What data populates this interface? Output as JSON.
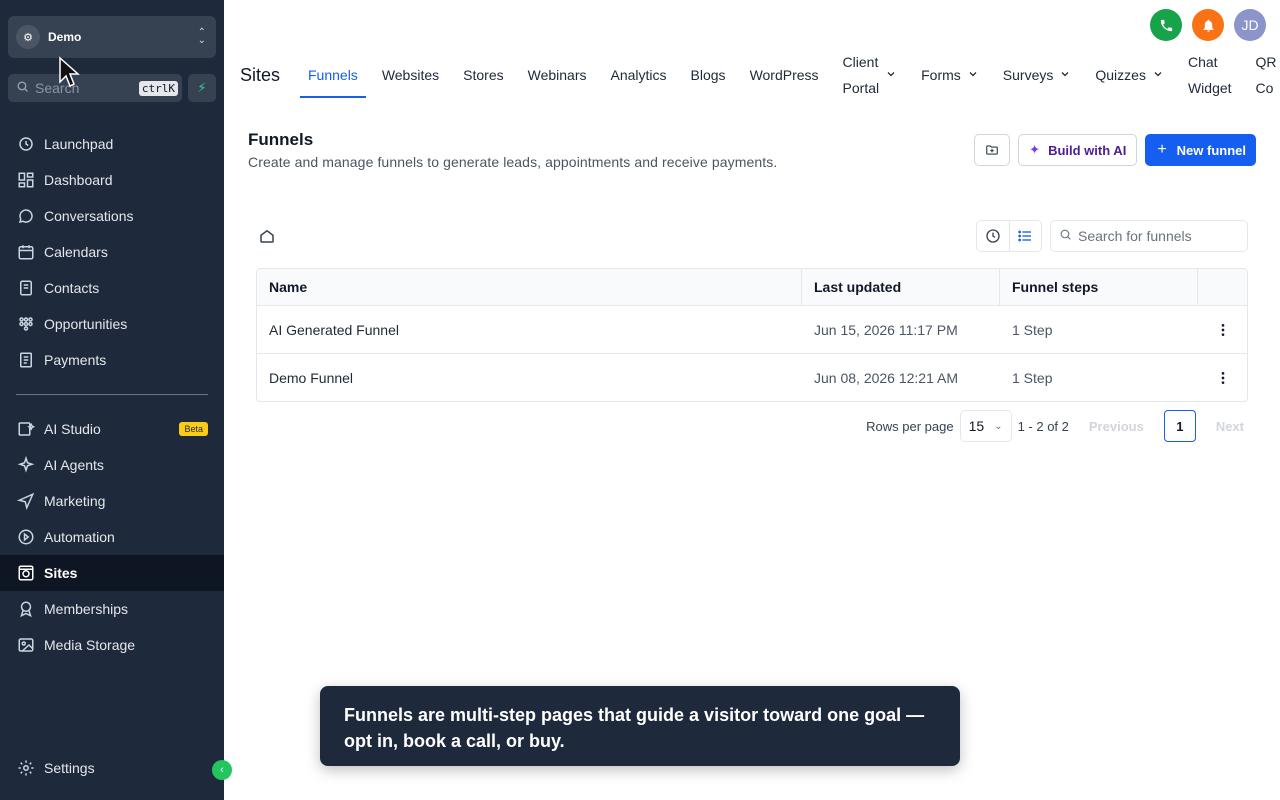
{
  "account": {
    "name": "Demo"
  },
  "sidebar_search": {
    "placeholder": "Search",
    "shortcut": "ctrlK"
  },
  "nav_group1": [
    {
      "label": "Launchpad",
      "icon": "launchpad-icon"
    },
    {
      "label": "Dashboard",
      "icon": "dashboard-icon"
    },
    {
      "label": "Conversations",
      "icon": "chat-icon"
    },
    {
      "label": "Calendars",
      "icon": "calendar-icon"
    },
    {
      "label": "Contacts",
      "icon": "contacts-icon"
    },
    {
      "label": "Opportunities",
      "icon": "opportunities-icon"
    },
    {
      "label": "Payments",
      "icon": "payments-icon"
    }
  ],
  "nav_group2": [
    {
      "label": "AI Studio",
      "icon": "ai-studio-icon",
      "badge": "Beta"
    },
    {
      "label": "AI Agents",
      "icon": "sparkle-icon"
    },
    {
      "label": "Marketing",
      "icon": "send-icon"
    },
    {
      "label": "Automation",
      "icon": "automation-icon"
    },
    {
      "label": "Sites",
      "icon": "globe-icon",
      "active": true
    },
    {
      "label": "Memberships",
      "icon": "award-icon"
    },
    {
      "label": "Media Storage",
      "icon": "image-icon"
    }
  ],
  "settings_label": "Settings",
  "header": {
    "section": "Sites",
    "avatar_initials": "JD",
    "tabs": [
      {
        "label": "Funnels",
        "active": true
      },
      {
        "label": "Websites"
      },
      {
        "label": "Stores"
      },
      {
        "label": "Webinars"
      },
      {
        "label": "Analytics"
      },
      {
        "label": "Blogs"
      },
      {
        "label": "WordPress"
      },
      {
        "label": "Client",
        "label2": "Portal",
        "dropdown": true
      },
      {
        "label": "Forms",
        "dropdown": true
      },
      {
        "label": "Surveys",
        "dropdown": true
      },
      {
        "label": "Quizzes",
        "dropdown": true
      },
      {
        "label": "Chat",
        "label2": "Widget"
      },
      {
        "label": "QR",
        "label2": "Co"
      }
    ]
  },
  "page": {
    "title": "Funnels",
    "subtitle": "Create and manage funnels to generate leads, appointments and receive payments.",
    "build_ai_label": "Build with AI",
    "new_funnel_label": "New funnel"
  },
  "table": {
    "search_placeholder": "Search for funnels",
    "columns": [
      "Name",
      "Last updated",
      "Funnel steps"
    ],
    "rows": [
      {
        "name": "AI Generated Funnel",
        "updated": "Jun 15, 2026 11:17 PM",
        "steps": "1 Step"
      },
      {
        "name": "Demo Funnel",
        "updated": "Jun 08, 2026 12:21 AM",
        "steps": "1 Step"
      }
    ]
  },
  "pagination": {
    "rows_per_page_label": "Rows per page",
    "rows_per_page": "15",
    "range": "1 - 2 of 2",
    "previous": "Previous",
    "current_page": "1",
    "next": "Next"
  },
  "tooltip": {
    "text": "Funnels are multi-step pages that guide a visitor toward one goal — opt in, book a call, or buy."
  },
  "colors": {
    "sidebar_bg": "#1e2a3b",
    "primary": "#155eef",
    "phone": "#16a34a",
    "bell": "#f97316"
  }
}
